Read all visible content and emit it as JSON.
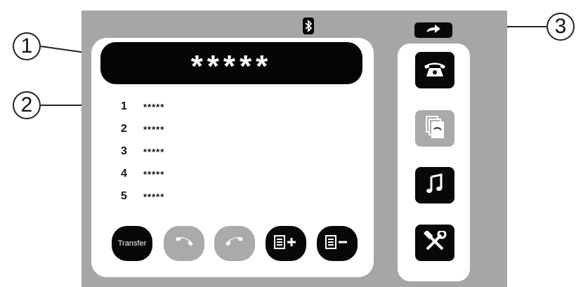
{
  "display": {
    "text": "*****"
  },
  "list": [
    {
      "num": "1",
      "value": "*****"
    },
    {
      "num": "2",
      "value": "*****"
    },
    {
      "num": "3",
      "value": "*****"
    },
    {
      "num": "4",
      "value": "*****"
    },
    {
      "num": "5",
      "value": "*****"
    }
  ],
  "buttons": {
    "transfer_label": "Transfer"
  },
  "callouts": {
    "c1": "1",
    "c2": "2",
    "c3": "3"
  },
  "icons": {
    "bluetooth": "bluetooth-icon",
    "back": "back-arrow-icon",
    "phone": "phone-icon",
    "contacts": "contacts-icon",
    "music": "music-icon",
    "settings": "tools-icon",
    "accept": "accept-call-icon",
    "hangup": "hangup-icon",
    "list_add": "list-add-icon",
    "list_remove": "list-remove-icon"
  },
  "colors": {
    "screen_bg": "#a6a6a6",
    "dark": "#080808",
    "disabled": "#aaaaaa"
  }
}
